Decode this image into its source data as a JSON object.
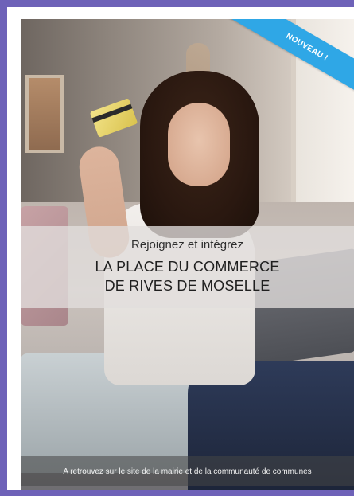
{
  "ribbon": {
    "label": "NOUVEAU !"
  },
  "banner": {
    "line1": "Rejoignez et intégrez",
    "line2": "LA PLACE DU COMMERCE",
    "line3": "DE RIVES DE MOSELLE"
  },
  "footer": {
    "text": "A retrouvez sur le site de la mairie et de la communauté de communes"
  },
  "colors": {
    "background": "#6e62b8",
    "ribbon": "#2fa7e6"
  }
}
